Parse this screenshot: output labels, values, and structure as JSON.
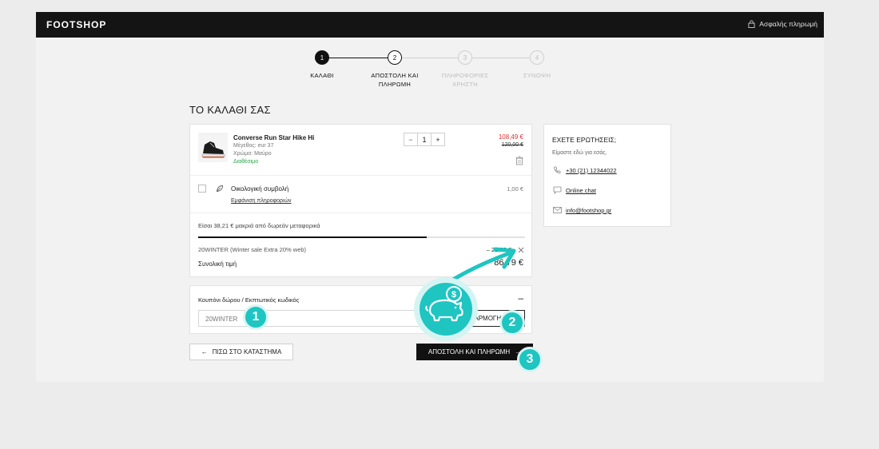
{
  "header": {
    "logo": "FOOTSHOP",
    "secure_label": "Ασφαλής πληρωμή"
  },
  "steps": [
    {
      "number": "1",
      "label": "ΚΑΛΑΘΙ",
      "state": "done"
    },
    {
      "number": "2",
      "label": "ΑΠΟΣΤΟΛΗ ΚΑΙ ΠΛΗΡΩΜΗ",
      "state": "current"
    },
    {
      "number": "3",
      "label": "ΠΛΗΡΟΦΟΡΙΕΣ ΧΡΗΣΤΗ",
      "state": "upcoming"
    },
    {
      "number": "4",
      "label": "ΣΥΝΟΨΗ",
      "state": "upcoming"
    }
  ],
  "cart": {
    "title": "ΤΟ ΚΑΛΑΘΙ ΣΑΣ",
    "product": {
      "name": "Converse Run Star Hike Hi",
      "size": "Μέγεθος: eur 37",
      "color": "Χρώμα: Μαύρο",
      "availability": "Διαθέσιμο",
      "quantity": "1",
      "price": "108,49 €",
      "old_price": "120,00 €"
    },
    "eco": {
      "label": "Οικολογική συμβολή",
      "link": "Εμφάνιση πληροφοριών",
      "price": "1,00 €"
    },
    "free_shipping_text": "Είσαι 38,21 € μακριά από δωρεάν μεταφορικά",
    "free_shipping_progress": 0.7,
    "discount": {
      "label": "20WINTER (Winter sale Extra 20% web)",
      "amount": "– 21,70 €"
    },
    "total_label": "Συνολική τιμή",
    "total_value": "86,79 €"
  },
  "coupon": {
    "title": "Κουπόνι δώρου / Εκπτωτικός κωδικός",
    "collapse_symbol": "–",
    "input_value": "20WINTER",
    "apply_label": "ΕΦΑΡΜΟΓΗ"
  },
  "actions": {
    "back_label": "ΠΙΣΩ ΣΤΟ ΚΑΤΑΣΤΗΜΑ",
    "continue_label": "ΑΠΟΣΤΟΛΗ ΚΑΙ ΠΛΗΡΩΜΗ"
  },
  "help": {
    "title": "ΕΧΕΤΕ ΕΡΩΤΗΣΕΙΣ;",
    "subtitle": "Είμαστε εδώ για εσάς.",
    "phone": "+30 (21) 12344022",
    "chat": "Online chat",
    "email": "info@footshop.gr"
  },
  "callouts": {
    "one": "1",
    "two": "2",
    "three": "3"
  },
  "colors": {
    "accent": "#1ec5c1",
    "price_red": "#e0322f",
    "available_green": "#2aa84a"
  }
}
